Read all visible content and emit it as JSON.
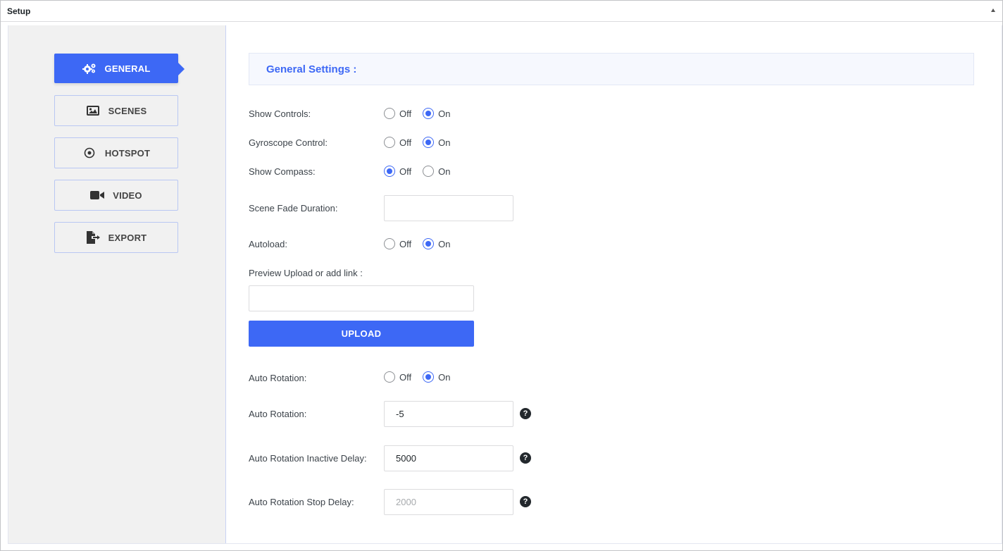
{
  "panel": {
    "title": "Setup"
  },
  "sidebar": {
    "items": [
      {
        "label": "GENERAL",
        "icon": "gears-icon",
        "active": true
      },
      {
        "label": "SCENES",
        "icon": "image-icon",
        "active": false
      },
      {
        "label": "HOTSPOT",
        "icon": "dot-circle-icon",
        "active": false
      },
      {
        "label": "VIDEO",
        "icon": "video-camera-icon",
        "active": false
      },
      {
        "label": "EXPORT",
        "icon": "file-export-icon",
        "active": false
      }
    ]
  },
  "main": {
    "section_title": "General Settings :",
    "radio_off_label": "Off",
    "radio_on_label": "On",
    "show_controls": {
      "label": "Show Controls:",
      "value": "On"
    },
    "gyroscope_control": {
      "label": "Gyroscope Control:",
      "value": "On"
    },
    "show_compass": {
      "label": "Show Compass:",
      "value": "Off"
    },
    "scene_fade_duration": {
      "label": "Scene Fade Duration:",
      "value": ""
    },
    "autoload": {
      "label": "Autoload:",
      "value": "On"
    },
    "preview": {
      "label": "Preview Upload or add link :",
      "value": "",
      "upload_label": "UPLOAD"
    },
    "auto_rotation_toggle": {
      "label": "Auto Rotation:",
      "value": "On"
    },
    "auto_rotation_speed": {
      "label": "Auto Rotation:",
      "value": "-5"
    },
    "auto_rotation_inactive_delay": {
      "label": "Auto Rotation Inactive Delay:",
      "value": "5000"
    },
    "auto_rotation_stop_delay": {
      "label": "Auto Rotation Stop Delay:",
      "placeholder": "2000"
    }
  },
  "colors": {
    "accent": "#3d68f5",
    "sidebar_bg": "#f1f1f1",
    "section_bg": "#f6f8fe"
  }
}
